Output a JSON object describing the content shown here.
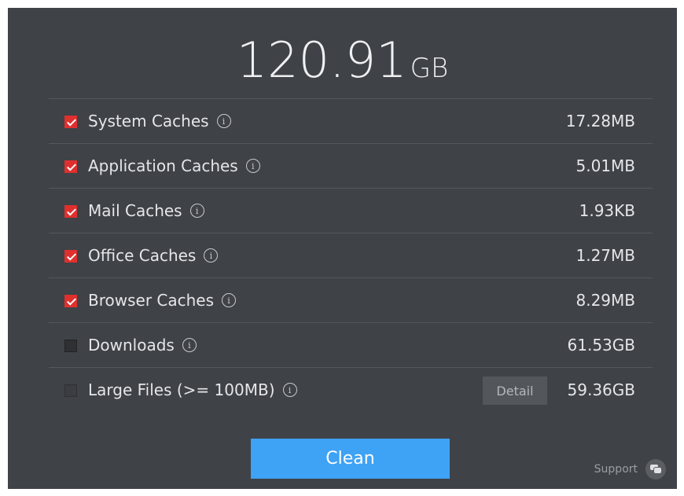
{
  "total": {
    "value": "120.91",
    "unit": "GB"
  },
  "items": [
    {
      "label": "System Caches",
      "size": "17.28MB",
      "checked": true
    },
    {
      "label": "Application Caches",
      "size": "5.01MB",
      "checked": true
    },
    {
      "label": "Mail Caches",
      "size": "1.93KB",
      "checked": true
    },
    {
      "label": "Office Caches",
      "size": "1.27MB",
      "checked": true
    },
    {
      "label": "Browser Caches",
      "size": "8.29MB",
      "checked": true
    },
    {
      "label": "Downloads",
      "size": "61.53GB",
      "checked": false
    },
    {
      "label": "Large Files (>= 100MB)",
      "size": "59.36GB",
      "checked": false,
      "detail_label": "Detail"
    }
  ],
  "info_icon_glyph": "i",
  "clean_label": "Clean",
  "support_label": "Support",
  "colors": {
    "panel": "#3f4247",
    "check": "#e0302e",
    "accent": "#3ea2f5"
  },
  "icons": {
    "info": "info-icon",
    "support": "chat-bubbles-icon",
    "check": "checkmark-icon"
  }
}
